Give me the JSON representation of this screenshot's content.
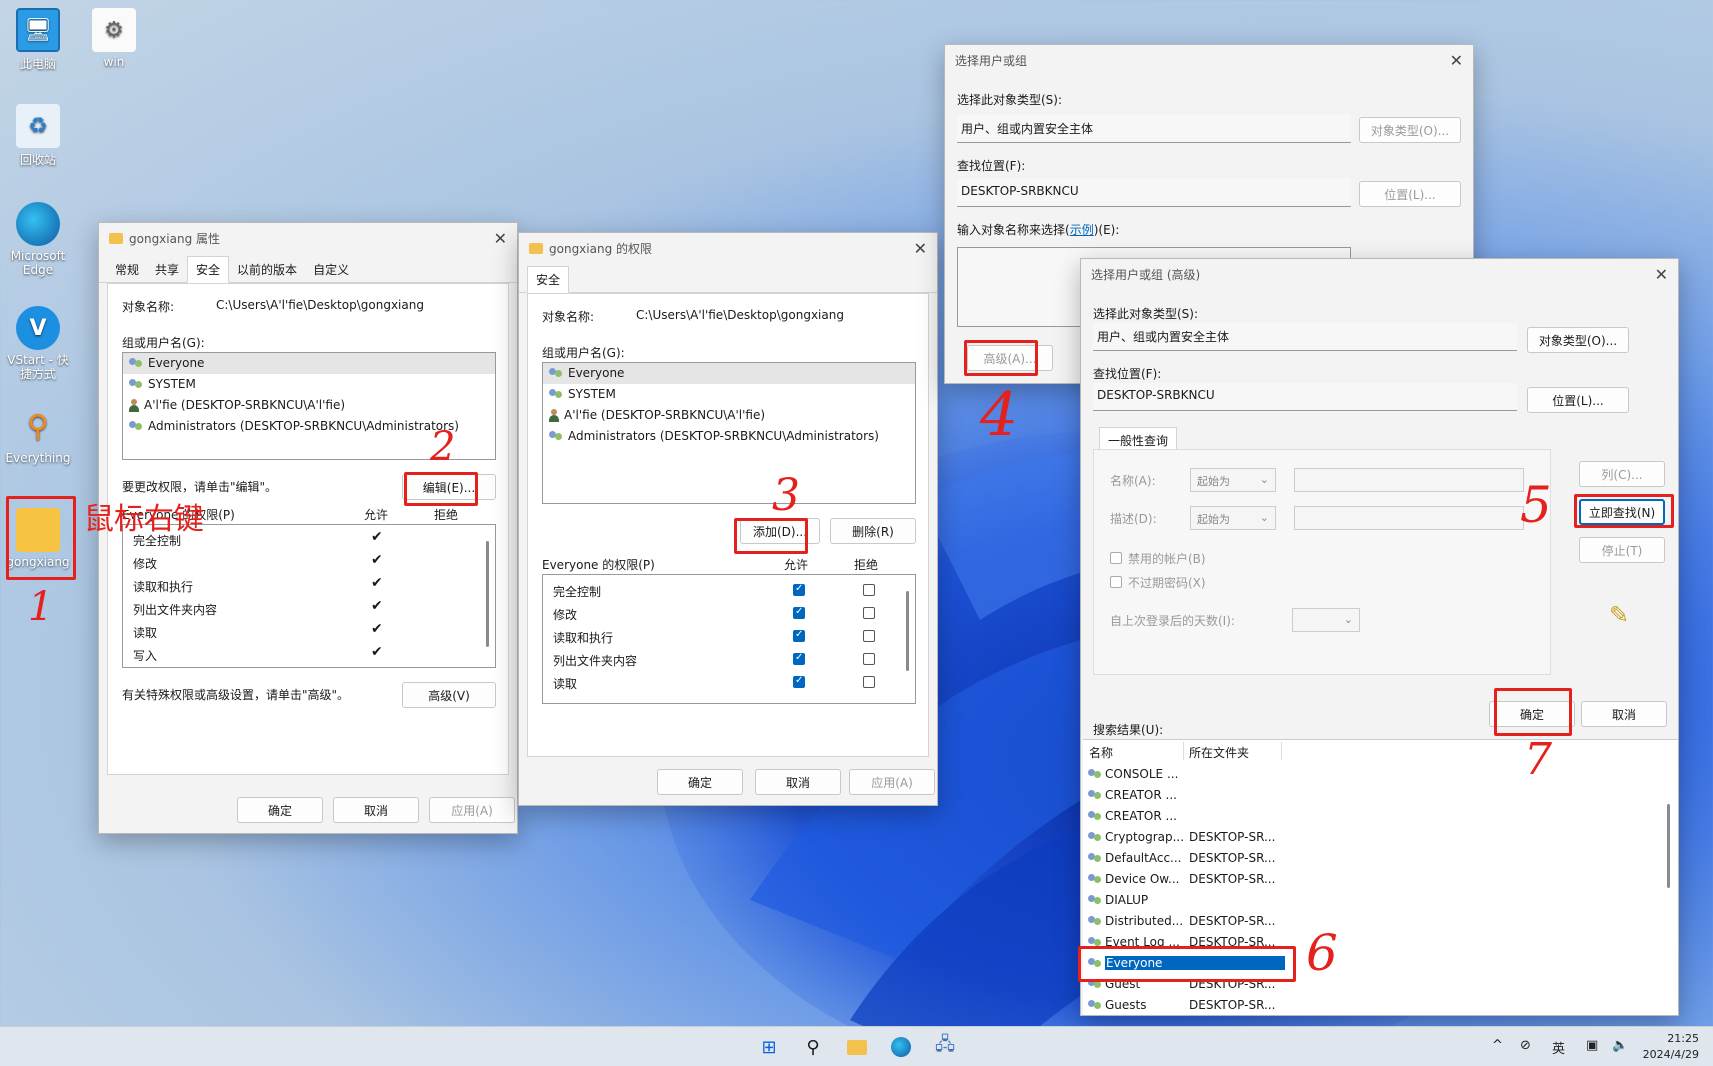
{
  "desktop": {
    "icons": [
      {
        "label": "此电脑",
        "icon": "monitor-icon"
      },
      {
        "label": "win",
        "icon": "gear-file-icon"
      },
      {
        "label": "回收站",
        "icon": "recycle-bin-icon"
      },
      {
        "label": "Microsoft Edge",
        "icon": "edge-icon"
      },
      {
        "label": "VStart - 快捷方式",
        "icon": "vstart-icon"
      },
      {
        "label": "Everything",
        "icon": "magnifier-icon"
      },
      {
        "label": "gongxiang",
        "icon": "folder-icon"
      }
    ]
  },
  "annotations": {
    "right_click": "鼠标右键",
    "steps": [
      "1",
      "2",
      "3",
      "4",
      "5",
      "6",
      "7"
    ],
    "color": "#e4211c"
  },
  "props_window": {
    "title": "gongxiang 属性",
    "tabs": [
      "常规",
      "共享",
      "安全",
      "以前的版本",
      "自定义"
    ],
    "object_label": "对象名称:",
    "object_value": "C:\\Users\\A'l'fie\\Desktop\\gongxiang",
    "group_label": "组或用户名(G):",
    "users": [
      "Everyone",
      "SYSTEM",
      "A'l'fie (DESKTOP-SRBKNCU\\A'l'fie)",
      "Administrators (DESKTOP-SRBKNCU\\Administrators)"
    ],
    "edit_hint": "要更改权限，请单击\"编辑\"。",
    "edit_btn": "编辑(E)...",
    "perm_label": "Everyone 的权限(P)",
    "allow": "允许",
    "deny": "拒绝",
    "perms": [
      "完全控制",
      "修改",
      "读取和执行",
      "列出文件夹内容",
      "读取",
      "写入"
    ],
    "special_hint": "有关特殊权限或高级设置，请单击\"高级\"。",
    "advanced_btn": "高级(V)",
    "ok": "确定",
    "cancel": "取消",
    "apply": "应用(A)"
  },
  "perm_window": {
    "title": "gongxiang 的权限",
    "tab": "安全",
    "object_label": "对象名称:",
    "object_value": "C:\\Users\\A'l'fie\\Desktop\\gongxiang",
    "group_label": "组或用户名(G):",
    "users": [
      "Everyone",
      "SYSTEM",
      "A'l'fie (DESKTOP-SRBKNCU\\A'l'fie)",
      "Administrators (DESKTOP-SRBKNCU\\Administrators)"
    ],
    "add_btn": "添加(D)...",
    "remove_btn": "删除(R)",
    "perm_label": "Everyone 的权限(P)",
    "allow": "允许",
    "deny": "拒绝",
    "perms": [
      "完全控制",
      "修改",
      "读取和执行",
      "列出文件夹内容",
      "读取"
    ],
    "ok": "确定",
    "cancel": "取消",
    "apply": "应用(A)"
  },
  "select_window": {
    "title": "选择用户或组",
    "type_label": "选择此对象类型(S):",
    "type_value": "用户、组或内置安全主体",
    "type_btn": "对象类型(O)...",
    "loc_label": "查找位置(F):",
    "loc_value": "DESKTOP-SRBKNCU",
    "loc_btn": "位置(L)...",
    "name_label": "输入对象名称来选择(",
    "name_link": "示例",
    "name_label_tail": ")(E):",
    "advanced_btn": "高级(A)..."
  },
  "adv_window": {
    "title": "选择用户或组 (高级)",
    "type_label": "选择此对象类型(S):",
    "type_value": "用户、组或内置安全主体",
    "type_btn": "对象类型(O)...",
    "loc_label": "查找位置(F):",
    "loc_value": "DESKTOP-SRBKNCU",
    "loc_btn": "位置(L)...",
    "tab": "一般性查询",
    "name_label": "名称(A):",
    "desc_label": "描述(D):",
    "starts_with": "起始为",
    "disabled_label": "禁用的帐户(B)",
    "noexpire_label": "不过期密码(X)",
    "days_label": "自上次登录后的天数(I):",
    "col_btn": "列(C)...",
    "find_btn": "立即查找(N)",
    "stop_btn": "停止(T)",
    "ok": "确定",
    "cancel": "取消",
    "results_label": "搜索结果(U):",
    "col_name": "名称",
    "col_folder": "所在文件夹",
    "results": [
      {
        "name": "CONSOLE ...",
        "folder": ""
      },
      {
        "name": "CREATOR ...",
        "folder": ""
      },
      {
        "name": "CREATOR ...",
        "folder": ""
      },
      {
        "name": "Cryptograp...",
        "folder": "DESKTOP-SR..."
      },
      {
        "name": "DefaultAcc...",
        "folder": "DESKTOP-SR..."
      },
      {
        "name": "Device Ow...",
        "folder": "DESKTOP-SR..."
      },
      {
        "name": "DIALUP",
        "folder": ""
      },
      {
        "name": "Distributed...",
        "folder": "DESKTOP-SR..."
      },
      {
        "name": "Event Log ...",
        "folder": "DESKTOP-SR..."
      },
      {
        "name": "Everyone",
        "folder": ""
      },
      {
        "name": "Guest",
        "folder": "DESKTOP-SR..."
      },
      {
        "name": "Guests",
        "folder": "DESKTOP-SR..."
      }
    ]
  },
  "taskbar": {
    "icons": [
      "windows-start-icon",
      "search-icon",
      "file-explorer-icon",
      "edge-icon",
      "network-app-icon"
    ],
    "tray": {
      "chevron": "^",
      "ime": "英"
    },
    "time": "21:25",
    "date": "2024/4/29"
  },
  "colors": {
    "accent": "#0067c0",
    "selection": "#0067c0",
    "annotation": "#e4211c"
  }
}
